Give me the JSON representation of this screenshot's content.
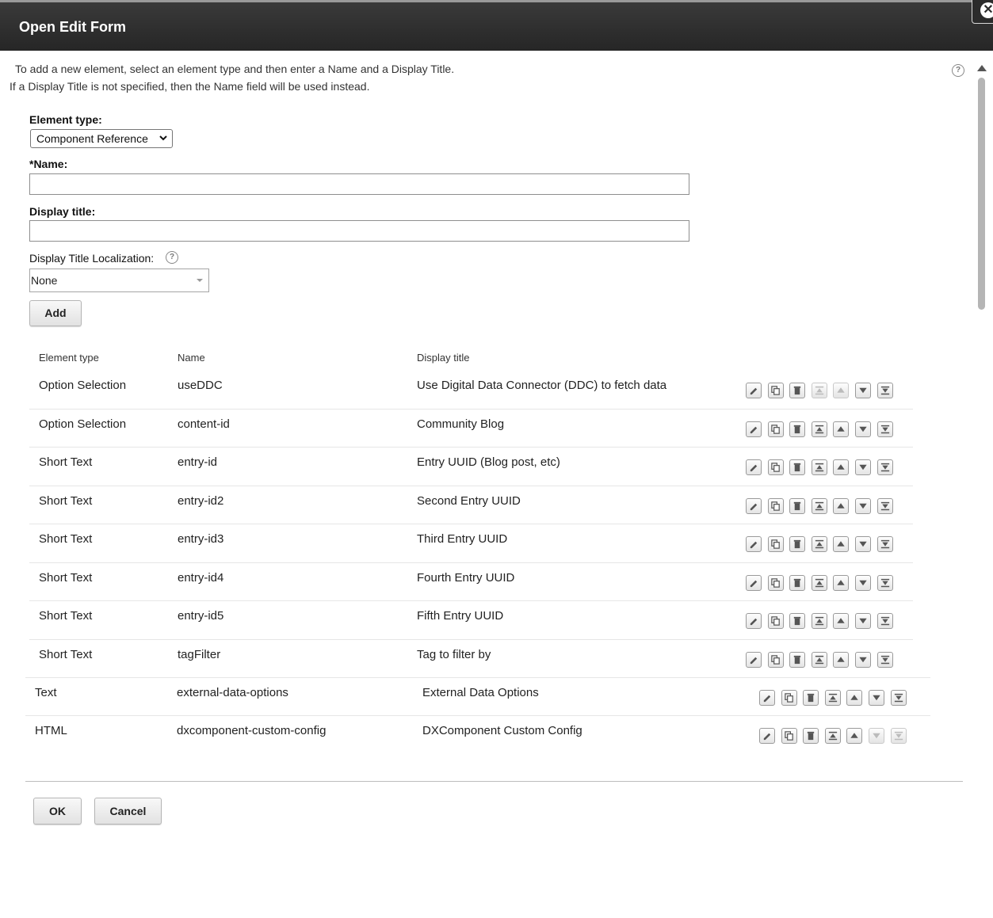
{
  "dialog": {
    "title": "Open Edit Form",
    "close_glyph": "✕"
  },
  "instructions": {
    "line1": "To add a new element, select an element type and then enter a Name and a Display Title.",
    "line2": "If a Display Title is not specified, then the Name field will be used instead."
  },
  "form": {
    "element_type_label": "Element type:",
    "element_type_value": "Component Reference",
    "name_label": "*Name:",
    "name_value": "",
    "display_title_label": "Display title:",
    "display_title_value": "",
    "localization_label": "Display Title Localization:",
    "localization_value": "None",
    "add_label": "Add"
  },
  "table": {
    "headers": {
      "type": "Element type",
      "name": "Name",
      "title": "Display title"
    },
    "rows": [
      {
        "type": "Option Selection",
        "name": "useDDC",
        "title": "Use Digital Data Connector (DDC) to fetch data",
        "first": true,
        "last": false
      },
      {
        "type": "Option Selection",
        "name": "content-id",
        "title": "Community Blog",
        "first": false,
        "last": false
      },
      {
        "type": "Short Text",
        "name": "entry-id",
        "title": "Entry UUID (Blog post, etc)",
        "first": false,
        "last": false
      },
      {
        "type": "Short Text",
        "name": "entry-id2",
        "title": "Second Entry UUID",
        "first": false,
        "last": false
      },
      {
        "type": "Short Text",
        "name": "entry-id3",
        "title": "Third Entry UUID",
        "first": false,
        "last": false
      },
      {
        "type": "Short Text",
        "name": "entry-id4",
        "title": "Fourth Entry UUID",
        "first": false,
        "last": false
      },
      {
        "type": "Short Text",
        "name": "entry-id5",
        "title": "Fifth Entry UUID",
        "first": false,
        "last": false
      },
      {
        "type": "Short Text",
        "name": "tagFilter",
        "title": "Tag to filter by",
        "first": false,
        "last": false
      },
      {
        "type": "Text",
        "name": "external-data-options",
        "title": "External Data Options",
        "first": false,
        "last": false
      },
      {
        "type": "HTML",
        "name": "dxcomponent-custom-config",
        "title": "DXComponent Custom Config",
        "first": false,
        "last": true
      }
    ],
    "action_icons": [
      "edit-icon",
      "copy-icon",
      "delete-icon",
      "move-top-icon",
      "move-up-icon",
      "move-down-icon",
      "move-bottom-icon"
    ]
  },
  "footer": {
    "ok_label": "OK",
    "cancel_label": "Cancel"
  },
  "help_glyph": "?",
  "colors": {
    "titlebar": "#2e2e2e",
    "row_separator": "#e6e6e6"
  }
}
